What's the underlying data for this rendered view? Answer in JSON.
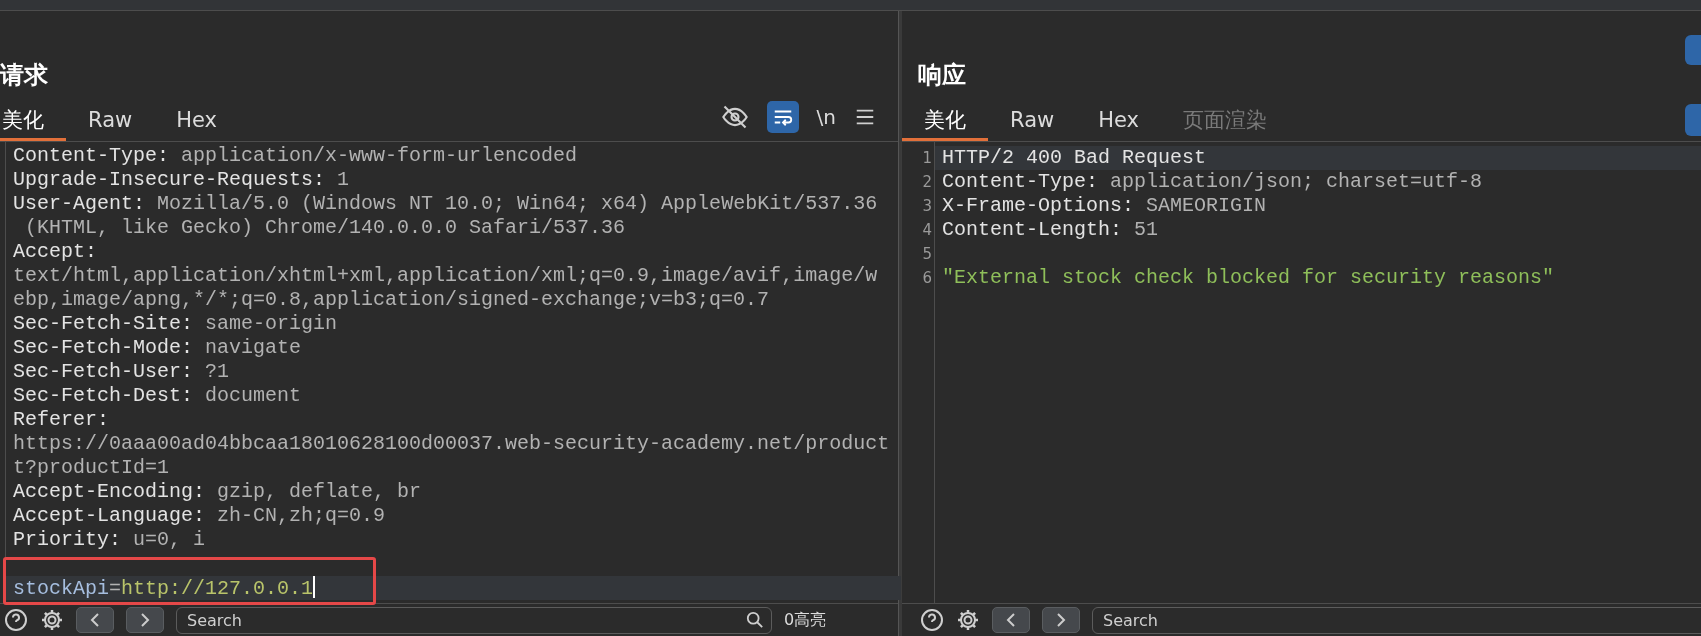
{
  "request": {
    "title": "请求",
    "tabs": [
      {
        "label": "美化",
        "selected": true,
        "disabled": false
      },
      {
        "label": "Raw",
        "selected": false,
        "disabled": false
      },
      {
        "label": "Hex",
        "selected": false,
        "disabled": false
      }
    ],
    "toolbar": [
      {
        "kind": "eye-off"
      },
      {
        "kind": "wrap",
        "on": true
      },
      {
        "kind": "text",
        "label": "\\n"
      },
      {
        "kind": "menu"
      }
    ],
    "lines": [
      {
        "kind": "header",
        "key": "Content-Type:",
        "value": " application/x-www-form-urlencoded",
        "current": false
      },
      {
        "kind": "header",
        "key": "Upgrade-Insecure-Requests:",
        "value": " 1",
        "current": false
      },
      {
        "kind": "header",
        "key": "User-Agent:",
        "value": " Mozilla/5.0 (Windows NT 10.0; Win64; x64) AppleWebKit/537.36",
        "current": false
      },
      {
        "kind": "plain",
        "text": " (KHTML, like Gecko) Chrome/140.0.0.0 Safari/537.36",
        "current": false
      },
      {
        "kind": "header",
        "key": "Accept:",
        "current": false
      },
      {
        "kind": "plain",
        "text": "text/html,application/xhtml+xml,application/xml;q=0.9,image/avif,image/w",
        "current": false
      },
      {
        "kind": "plain",
        "text": "ebp,image/apng,*/*;q=0.8,application/signed-exchange;v=b3;q=0.7",
        "current": false
      },
      {
        "kind": "header",
        "key": "Sec-Fetch-Site:",
        "value": " same-origin",
        "current": false
      },
      {
        "kind": "header",
        "key": "Sec-Fetch-Mode:",
        "value": " navigate",
        "current": false
      },
      {
        "kind": "header",
        "key": "Sec-Fetch-User:",
        "value": " ?1",
        "current": false
      },
      {
        "kind": "header",
        "key": "Sec-Fetch-Dest:",
        "value": " document",
        "current": false
      },
      {
        "kind": "header",
        "key": "Referer:",
        "current": false
      },
      {
        "kind": "plain",
        "text": "https://0aaa00ad04bbcaa18010628100d00037.web-security-academy.net/product",
        "current": false
      },
      {
        "kind": "plain",
        "text": "t?productId=1",
        "current": false
      },
      {
        "kind": "header",
        "key": "Accept-Encoding:",
        "value": " gzip, deflate, br",
        "current": false
      },
      {
        "kind": "header",
        "key": "Accept-Language:",
        "value": " zh-CN,zh;q=0.9",
        "current": false
      },
      {
        "kind": "header",
        "key": "Priority:",
        "value": " u=0, i",
        "current": false
      },
      {
        "kind": "blank",
        "current": false
      },
      {
        "kind": "param",
        "key": "stockApi",
        "sep": "=",
        "value": "http://127.0.0.1",
        "current": true,
        "boxed": true,
        "cursor": true
      }
    ],
    "search": {
      "placeholder": "Search"
    },
    "match_count": "0高亮"
  },
  "response": {
    "title": "响应",
    "tabs": [
      {
        "label": "美化",
        "selected": true,
        "disabled": false
      },
      {
        "label": "Raw",
        "selected": false,
        "disabled": false
      },
      {
        "label": "Hex",
        "selected": false,
        "disabled": false
      },
      {
        "label": "页面渲染",
        "selected": false,
        "disabled": true
      }
    ],
    "lines": [
      {
        "number": "1",
        "kind": "status",
        "text": "HTTP/2 400 Bad Request",
        "current": true
      },
      {
        "number": "2",
        "kind": "header",
        "key": "Content-Type:",
        "value": " application/json; charset=utf-8",
        "current": false
      },
      {
        "number": "3",
        "kind": "header",
        "key": "X-Frame-Options:",
        "value": " SAMEORIGIN",
        "current": false
      },
      {
        "number": "4",
        "kind": "header",
        "key": "Content-Length:",
        "value": " 51",
        "current": false
      },
      {
        "number": "5",
        "kind": "blank",
        "current": false
      },
      {
        "number": "6",
        "kind": "string",
        "text": "\"External stock check blocked for security reasons\"",
        "current": false
      }
    ],
    "search": {
      "placeholder": "Search"
    }
  }
}
